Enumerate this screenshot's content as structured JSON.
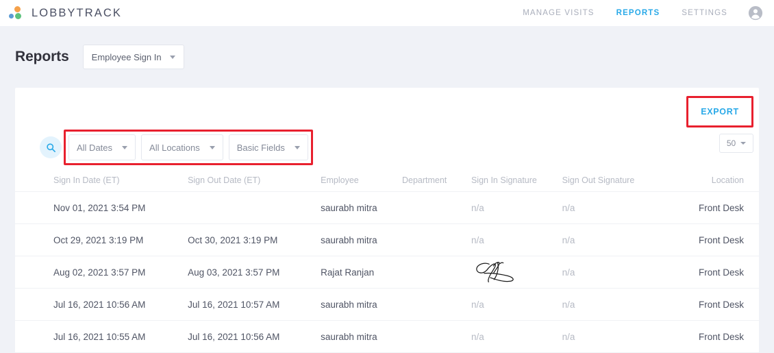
{
  "brand": {
    "name": "LOBBYTRACK"
  },
  "nav": {
    "items": [
      {
        "label": "MANAGE VISITS",
        "active": false
      },
      {
        "label": "REPORTS",
        "active": true
      },
      {
        "label": "SETTINGS",
        "active": false
      }
    ],
    "avatar_icon": "user-avatar-icon"
  },
  "page": {
    "title": "Reports",
    "report_type": "Employee Sign In"
  },
  "toolbar": {
    "export_label": "EXPORT",
    "search_icon": "search-icon",
    "filters": [
      {
        "label": "All Dates"
      },
      {
        "label": "All Locations"
      },
      {
        "label": "Basic Fields"
      }
    ],
    "page_size": "50"
  },
  "table": {
    "columns": [
      "Sign In Date (ET)",
      "Sign Out Date (ET)",
      "Employee",
      "Department",
      "Sign In Signature",
      "Sign Out Signature",
      "Location"
    ],
    "rows": [
      {
        "sign_in_date": "Nov 01, 2021 3:54 PM",
        "sign_out_date": "",
        "employee": "saurabh mitra",
        "department": "",
        "sign_in_signature": "n/a",
        "sign_out_signature": "n/a",
        "location": "Front Desk"
      },
      {
        "sign_in_date": "Oct 29, 2021 3:19 PM",
        "sign_out_date": "Oct 30, 2021 3:19 PM",
        "employee": "saurabh mitra",
        "department": "",
        "sign_in_signature": "n/a",
        "sign_out_signature": "n/a",
        "location": "Front Desk"
      },
      {
        "sign_in_date": "Aug 02, 2021 3:57 PM",
        "sign_out_date": "Aug 03, 2021 3:57 PM",
        "employee": "Rajat Ranjan",
        "department": "",
        "sign_in_signature": "signature-image",
        "sign_out_signature": "n/a",
        "location": "Front Desk"
      },
      {
        "sign_in_date": "Jul 16, 2021 10:56 AM",
        "sign_out_date": "Jul 16, 2021 10:57 AM",
        "employee": "saurabh mitra",
        "department": "",
        "sign_in_signature": "n/a",
        "sign_out_signature": "n/a",
        "location": "Front Desk"
      },
      {
        "sign_in_date": "Jul 16, 2021 10:55 AM",
        "sign_out_date": "Jul 16, 2021 10:56 AM",
        "employee": "saurabh mitra",
        "department": "",
        "sign_in_signature": "n/a",
        "sign_out_signature": "n/a",
        "location": "Front Desk"
      }
    ]
  },
  "colors": {
    "accent_blue": "#29a9e8",
    "annotation_red": "#e8202e",
    "page_background": "#f0f2f7",
    "logo_orange": "#f5a14b",
    "logo_blue": "#5b9bd5",
    "logo_green": "#5dc27e"
  }
}
